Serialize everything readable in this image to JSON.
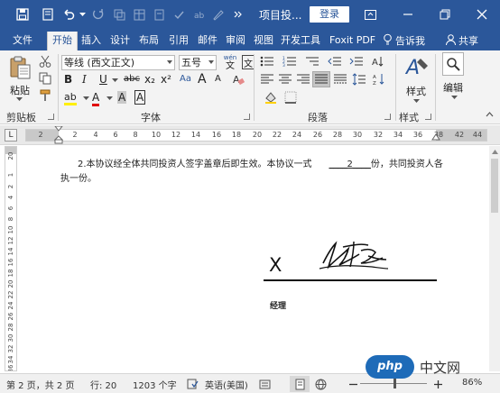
{
  "title_bar": {
    "doc_title": "项目投...",
    "login_button": "登录"
  },
  "tabs": [
    "文件",
    "开始",
    "插入",
    "设计",
    "布局",
    "引用",
    "邮件",
    "审阅",
    "视图",
    "开发工具",
    "Foxit PDF"
  ],
  "tab_right": {
    "tell_me": "告诉我",
    "share": "共享"
  },
  "ribbon": {
    "clipboard": {
      "paste": "粘贴",
      "group_label": "剪贴板"
    },
    "font": {
      "font_name": "等线 (西文正文)",
      "font_size": "五号",
      "wen": "wén",
      "wen_char": "文",
      "bold": "B",
      "italic": "I",
      "underline": "U",
      "strike": "abc",
      "subscript": "x₂",
      "superscript": "x²",
      "change_case": "Aa",
      "grow": "A",
      "shrink": "A",
      "highlight": "ab",
      "font_color": "A",
      "char_shading": "A",
      "char_border": "A",
      "group_label": "字体"
    },
    "paragraph": {
      "group_label": "段落"
    },
    "styles": {
      "label": "样式",
      "group_label": "样式"
    },
    "editing": {
      "label": "编辑"
    }
  },
  "ruler": {
    "corner": "L",
    "ticks": [
      "2",
      "2",
      "4",
      "6",
      "8",
      "10",
      "12",
      "14",
      "16",
      "18",
      "20",
      "22",
      "24",
      "26",
      "28",
      "30",
      "32",
      "34",
      "36",
      "38",
      "42",
      "44"
    ],
    "vticks": [
      "20",
      "1",
      "2",
      "4",
      "6",
      "8",
      "10",
      "12",
      "14",
      "16",
      "18",
      "20",
      "22",
      "24",
      "26",
      "28",
      "30",
      "32",
      "34",
      "36",
      "38"
    ]
  },
  "document": {
    "paragraph_before": "2.本协议经全体共同投资人签字盖章后即生效。本协议一式",
    "copies_blank": "____2____",
    "paragraph_after": "份，共同投资人各执一份。",
    "signature_x": "X",
    "signer_title": "经理"
  },
  "status": {
    "page": "第 2 页，共 2 页",
    "line": "行: 20",
    "words": "1203 个字",
    "language": "英语(美国)",
    "zoom": "86%"
  },
  "watermark": {
    "logo": "php",
    "text": "中文网"
  }
}
